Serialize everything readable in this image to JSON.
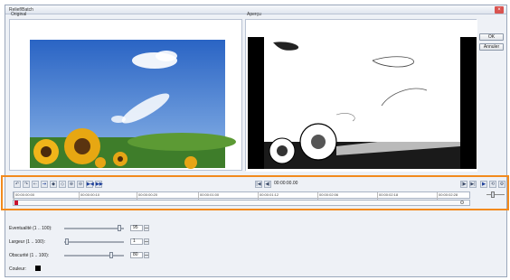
{
  "window": {
    "title": "Relief/Batch",
    "close_glyph": "×"
  },
  "panes": {
    "original_label": "Original",
    "preview_label": "Aperçu"
  },
  "buttons": {
    "ok": "OK",
    "cancel": "Annuler"
  },
  "timeline": {
    "timecode": "00:00:00.00",
    "ticks": [
      "00:00:00:00",
      "00:00:00:10",
      "00:00:00:20",
      "00:00:01:00",
      "00:00:01:12",
      "00:00:02:06",
      "00:00:02:18",
      "00:00:02:28"
    ],
    "tool_icons": [
      "↶",
      "↷",
      "⇠",
      "⇢",
      "◆",
      "◇",
      "⊕",
      "⊖",
      "▶◀",
      "▶▶"
    ],
    "nav_icons": {
      "first": "|◀",
      "prev": "◀|",
      "next": "|▶",
      "last": "▶|",
      "play": "▶",
      "loop": "⟲"
    }
  },
  "properties": [
    {
      "label": "Eventualité (1 .. 100):",
      "value": "95",
      "level": 0.95
    },
    {
      "label": "Largeur (1 .. 100):",
      "value": "1",
      "level": 0.01
    },
    {
      "label": "Obscurité (1 .. 100):",
      "value": "80",
      "level": 0.8
    }
  ],
  "color": {
    "label": "Couleur:",
    "value": "#000000"
  },
  "accent": "#f28a1d"
}
